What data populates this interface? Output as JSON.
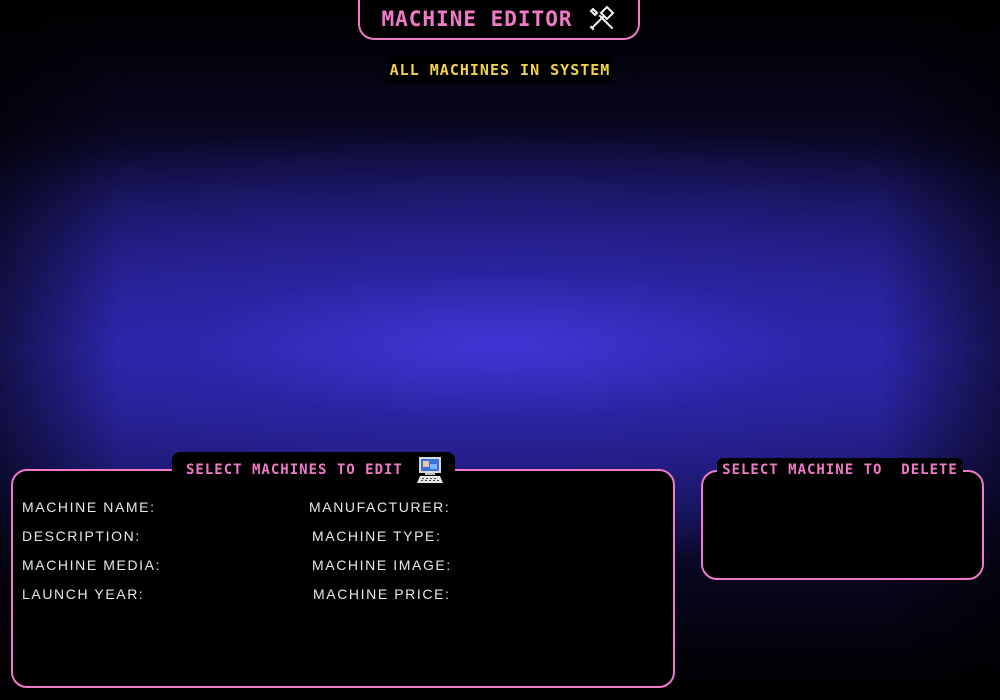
{
  "header": {
    "title": "MACHINE EDITOR",
    "title_icon": "wrench-screwdriver-icon",
    "subtitle": "ALL MACHINES IN SYSTEM"
  },
  "edit_panel": {
    "heading": "SELECT MACHINES TO EDIT",
    "heading_icon": "computer-icon",
    "fields": {
      "machine_name": "MACHINE NAME:",
      "manufacturer": "MANUFACTURER:",
      "description": "DESCRIPTION:",
      "machine_type": "MACHINE TYPE:",
      "machine_media": "MACHINE MEDIA:",
      "machine_image": "MACHINE IMAGE:",
      "launch_year": "LAUNCH YEAR:",
      "machine_price": "MACHINE PRICE:"
    }
  },
  "delete_panel": {
    "heading": "SELECT MACHINE TO  DELETE"
  },
  "colors": {
    "accent": "#f07ac8",
    "subtitle": "#f3d24a",
    "panel_bg": "#000000",
    "label_text": "#e8e8e8"
  }
}
